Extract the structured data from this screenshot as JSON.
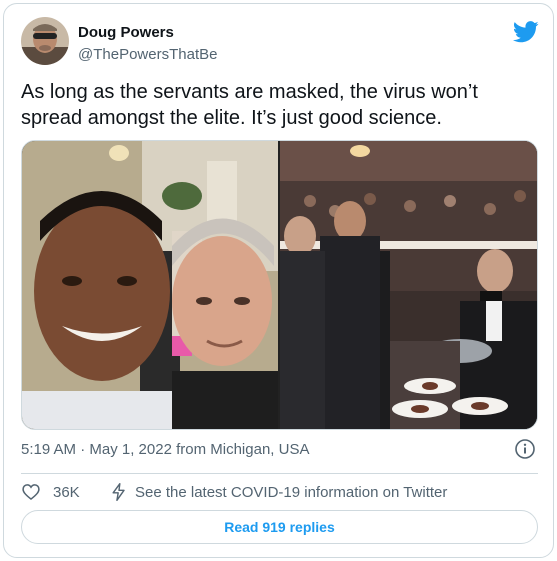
{
  "author": {
    "display_name": "Doug Powers",
    "handle": "@ThePowersThatBe"
  },
  "tweet": {
    "text": "As long as the servants are masked, the virus won’t spread amongst the elite. It’s just good science."
  },
  "meta": {
    "timestamp": "5:19 AM · May 1, 2022 from Michigan, USA"
  },
  "actions": {
    "like_count": "36K",
    "covid_link": "See the latest COVID-19 information on Twitter",
    "read_replies": "Read 919 replies"
  },
  "colors": {
    "accent": "#1d9bf0",
    "secondary_text": "#536471",
    "border": "#cfd9de"
  },
  "icons": [
    "twitter-bird-icon",
    "info-icon",
    "heart-icon",
    "bolt-icon"
  ]
}
